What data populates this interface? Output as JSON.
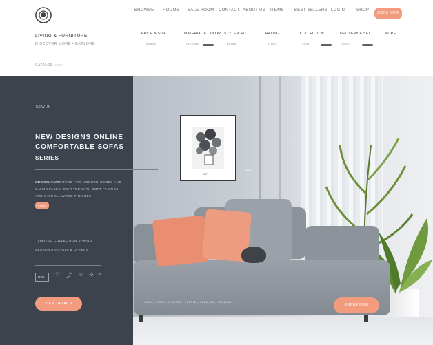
{
  "brand": {
    "logo_icon": "round-emblem-icon"
  },
  "nav": {
    "items": [
      "BROWSE",
      "ROOMS",
      "SALE ROOM",
      "CONTACT",
      "ABOUT US",
      "ITEMS",
      "BEST SELLERS",
      "LOGIN",
      "SHOP"
    ],
    "cta": "BOOK NOW"
  },
  "subheader": {
    "title": "LIVING & FURNITURE",
    "subtitle": "DISCOVER MORE • EXPLORE",
    "breadcrumb": "CATALOG",
    "breadcrumb_tail": "HOME"
  },
  "filters": [
    {
      "label": "PRICE & SIZE",
      "sub": "RANGE"
    },
    {
      "label": "MATERIAL & COLOR",
      "sub": "OPTIONS"
    },
    {
      "label": "STYLE & FIT",
      "sub": "FILTER"
    },
    {
      "label": "RATING",
      "sub": "STARS"
    },
    {
      "label": "COLLECTION",
      "sub": "VIEW"
    },
    {
      "label": "DELIVERY & SET",
      "sub": "FREE"
    }
  ],
  "filter_more": "MORE",
  "hero": {
    "tag": "NEW IN",
    "title_line1": "NEW DESIGNS ONLINE",
    "title_line2": "COMFORTABLE SOFAS",
    "title_line3": "SERIES",
    "meta": "ADD TO CART",
    "desc_line1": "MINIMAL FURNITURE FOR MODERN HOMES AND",
    "desc_line2": "CALM SPACES, CRAFTED WITH SOFT FABRICS",
    "desc_line3": "AND NATURAL WOOD FINISHES",
    "small_btn": "SHOP",
    "feature_line1": "LIMITED COLLECTION SPRING",
    "feature_line2": "SEASON ARRIVALS & OFFERS",
    "code": "DSN",
    "icons": [
      "heart-icon",
      "share-icon",
      "star-icon",
      "bookmark-icon"
    ],
    "cta_left": "VIEW DETAILS",
    "cta_right": "ORDER NOW",
    "sofa_caption": "SOFA • GREY • 3 SEATS • FABRIC • PREMIUM • DELIVERY",
    "frame_label": "ART",
    "hotspot": "INFO"
  },
  "colors": {
    "accent": "#f39b7f",
    "panel": "#3c434d",
    "wall": "#c8ced6"
  }
}
